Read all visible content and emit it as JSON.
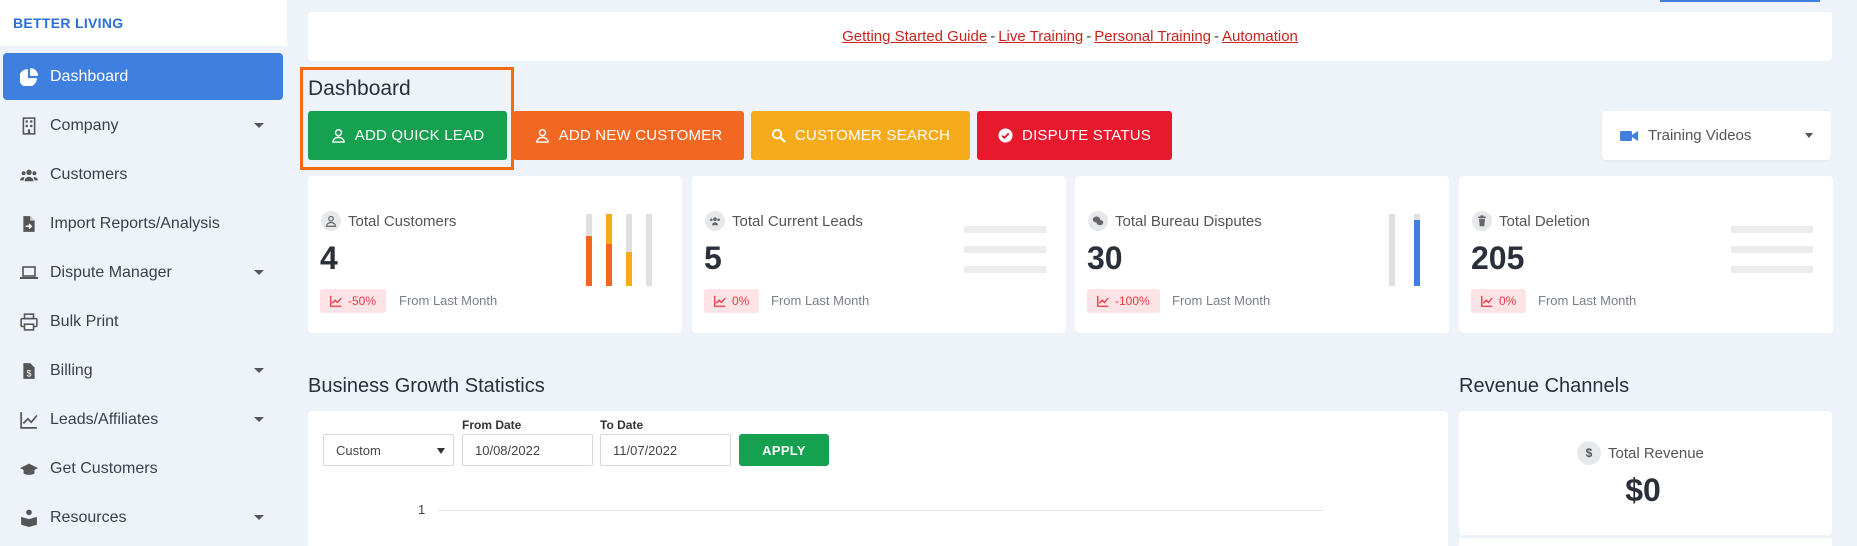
{
  "sidebar": {
    "brand": "BETTER LIVING",
    "items": [
      {
        "label": "Dashboard",
        "icon": "pie-chart-icon",
        "active": true,
        "dropdown": false
      },
      {
        "label": "Company",
        "icon": "building-icon",
        "dropdown": true
      },
      {
        "label": "Customers",
        "icon": "users-icon",
        "dropdown": false
      },
      {
        "label": "Import Reports/Analysis",
        "icon": "file-import-icon",
        "dropdown": false
      },
      {
        "label": "Dispute Manager",
        "icon": "laptop-icon",
        "dropdown": true
      },
      {
        "label": "Bulk Print",
        "icon": "printer-icon",
        "dropdown": false
      },
      {
        "label": "Billing",
        "icon": "invoice-icon",
        "dropdown": true
      },
      {
        "label": "Leads/Affiliates",
        "icon": "chart-line-icon",
        "dropdown": true
      },
      {
        "label": "Get Customers",
        "icon": "graduation-cap-icon",
        "dropdown": false
      },
      {
        "label": "Resources",
        "icon": "book-reader-icon",
        "dropdown": true
      }
    ]
  },
  "linkbar": {
    "links": [
      "Getting Started Guide",
      "Live Training",
      "Personal Training",
      "Automation"
    ],
    "separator": "-"
  },
  "page_title": "Dashboard",
  "actions": {
    "quick_lead": "ADD QUICK LEAD",
    "new_customer": "ADD NEW CUSTOMER",
    "customer_search": "CUSTOMER SEARCH",
    "dispute_status": "DISPUTE STATUS"
  },
  "training_select": {
    "value": "Training Videos",
    "icon": "video-camera-icon"
  },
  "stats": [
    {
      "label": "Total Customers",
      "value": "4",
      "change": "-50%",
      "from": "From Last Month",
      "icon": "user-icon"
    },
    {
      "label": "Total Current Leads",
      "value": "5",
      "change": "0%",
      "from": "From Last Month",
      "icon": "users-icon"
    },
    {
      "label": "Total Bureau Disputes",
      "value": "30",
      "change": "-100%",
      "from": "From Last Month",
      "icon": "comments-icon"
    },
    {
      "label": "Total Deletion",
      "value": "205",
      "change": "0%",
      "from": "From Last Month",
      "icon": "trash-icon"
    }
  ],
  "growth": {
    "title": "Business Growth Statistics",
    "range_value": "Custom",
    "from_label": "From Date",
    "from_value": "10/08/2022",
    "to_label": "To Date",
    "to_value": "11/07/2022",
    "apply": "APPLY",
    "y_tick": "1"
  },
  "revenue": {
    "title": "Revenue Channels",
    "label": "Total Revenue",
    "currency_icon": "$",
    "value": "$0"
  },
  "colors": {
    "accent": "#3f7fe0",
    "green": "#15a14f",
    "orange": "#f26722",
    "yellow": "#f6ab1b",
    "red": "#e8192c",
    "highlight": "#f26a12"
  }
}
